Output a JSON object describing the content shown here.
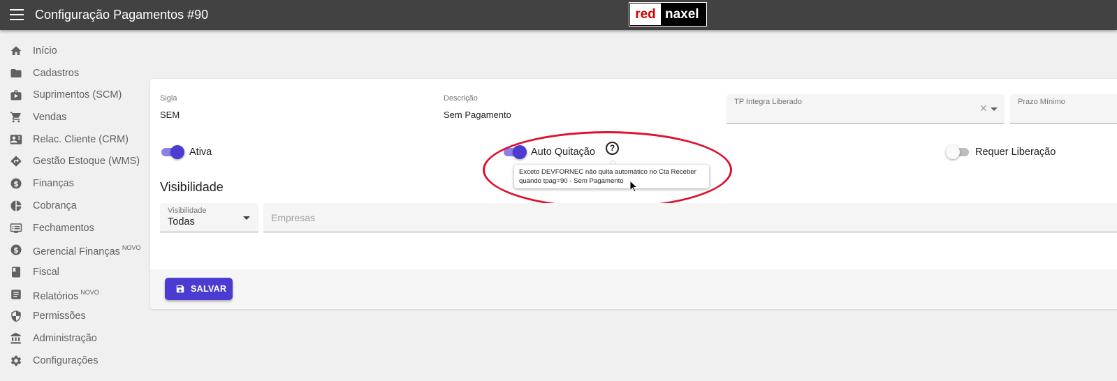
{
  "header": {
    "title": "Configuração Pagamentos #90",
    "logo_red": "red",
    "logo_white": "naxel"
  },
  "sidebar": {
    "items": [
      {
        "label": "Início",
        "icon": "home-icon",
        "badge": ""
      },
      {
        "label": "Cadastros",
        "icon": "folder-icon",
        "badge": ""
      },
      {
        "label": "Suprimentos (SCM)",
        "icon": "briefcase-icon",
        "badge": ""
      },
      {
        "label": "Vendas",
        "icon": "cart-icon",
        "badge": ""
      },
      {
        "label": "Relac. Cliente (CRM)",
        "icon": "contact-card-icon",
        "badge": ""
      },
      {
        "label": "Gestão Estoque (WMS)",
        "icon": "directions-icon",
        "badge": ""
      },
      {
        "label": "Finanças",
        "icon": "dollar-icon",
        "badge": ""
      },
      {
        "label": "Cobrança",
        "icon": "pie-chart-icon",
        "badge": ""
      },
      {
        "label": "Fechamentos",
        "icon": "list-icon",
        "badge": ""
      },
      {
        "label": "Gerencial Finanças",
        "icon": "dollar-icon",
        "badge": "NOVO"
      },
      {
        "label": "Fiscal",
        "icon": "book-icon",
        "badge": ""
      },
      {
        "label": "Relatórios",
        "icon": "report-icon",
        "badge": "NOVO"
      },
      {
        "label": "Permissões",
        "icon": "shield-icon",
        "badge": ""
      },
      {
        "label": "Administração",
        "icon": "bank-icon",
        "badge": ""
      },
      {
        "label": "Configurações",
        "icon": "gear-icon",
        "badge": ""
      }
    ]
  },
  "form": {
    "sigla_label": "Sigla",
    "sigla_value": "SEM",
    "descricao_label": "Descrição",
    "descricao_value": "Sem Pagamento",
    "tp_integra_label": "TP Integra Liberado",
    "prazo_minimo_label": "Prazo Mínimo",
    "ativa_label": "Ativa",
    "ativa_on": true,
    "auto_quitacao_label": "Auto Quitação",
    "auto_quitacao_on": true,
    "requer_liberacao_label": "Requer Liberação",
    "requer_liberacao_on": false,
    "tooltip_text": "Exceto DEVFORNEC não quita automático no Cta Receber quando tpag=90 - Sem Pagamento",
    "visibilidade_section": "Visibilidade",
    "visibilidade_label": "Visibilidade",
    "visibilidade_value": "Todas",
    "empresas_placeholder": "Empresas",
    "save_label": "SALVAR"
  },
  "colors": {
    "accent": "#4b3bd1",
    "topbar": "#424242",
    "highlight": "#e0102c"
  }
}
